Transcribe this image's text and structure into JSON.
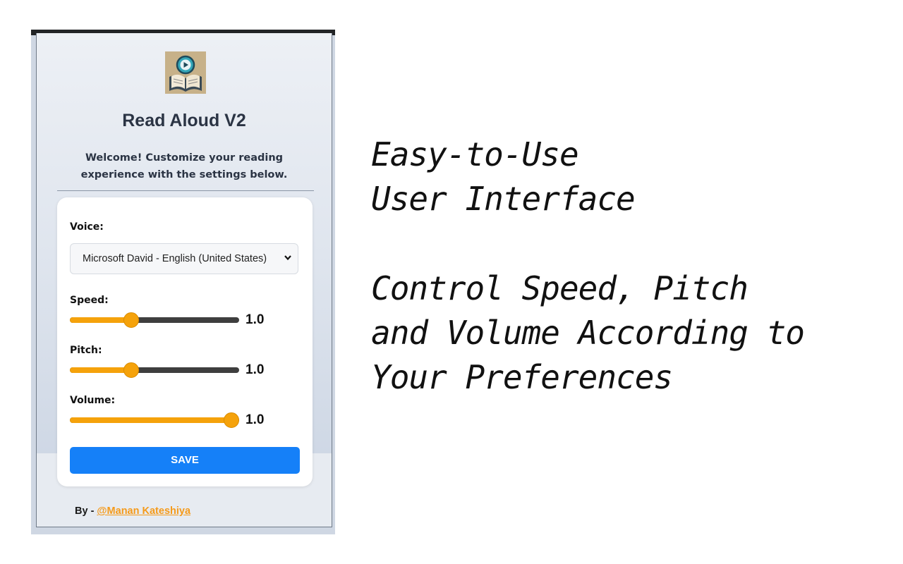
{
  "popup": {
    "logo_icon": "book-play-icon",
    "title": "Read Aloud V2",
    "welcome": "Welcome! Customize your reading experience with the settings below.",
    "voice": {
      "label": "Voice:",
      "selected": "Microsoft David - English (United States)"
    },
    "sliders": [
      {
        "label": "Speed:",
        "value": 1.0,
        "value_text": "1.0",
        "fraction": 0.35
      },
      {
        "label": "Pitch:",
        "value": 1.0,
        "value_text": "1.0",
        "fraction": 0.35
      },
      {
        "label": "Volume:",
        "value": 1.0,
        "value_text": "1.0",
        "fraction": 1.0
      }
    ],
    "save_label": "SAVE",
    "footer": {
      "prefix": "By - ",
      "link": "@Manan Kateshiya"
    },
    "accent_color": "#f5a20b",
    "button_color": "#1580f8"
  },
  "features": {
    "line1": "Easy-to-Use",
    "line2": "User Interface",
    "line3": "Control Speed, Pitch",
    "line4": "and Volume According to",
    "line5": "Your Preferences"
  }
}
